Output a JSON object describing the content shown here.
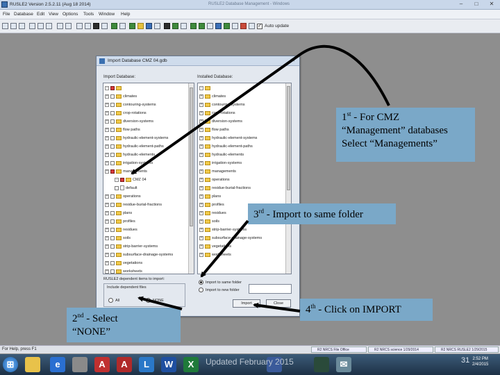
{
  "app": {
    "title": "RUSLE2 Version 2.5.2.11 (Aug 18 2014)",
    "window_title_center": "RUSLE2 Database Management - Windows",
    "min_glyph": "–",
    "max_glyph": "□",
    "close_glyph": "✕"
  },
  "menu": [
    "File",
    "Database",
    "Edit",
    "View",
    "Options",
    "Tools",
    "Window",
    "Help"
  ],
  "toolbar": {
    "checkbox_mark": "✓",
    "checkbox_label": "Auto update"
  },
  "dialog": {
    "title": "Import Database CMZ 04.gdb",
    "close_glyph": "✕",
    "import_label": "Import Database:",
    "installed_label": "Installed Database:",
    "import_tree": [
      {
        "label": "",
        "type": "root",
        "checked": true
      },
      {
        "label": "climates",
        "type": "item"
      },
      {
        "label": "contouring-systems",
        "type": "item"
      },
      {
        "label": "crop-rotations",
        "type": "item"
      },
      {
        "label": "diversion-systems",
        "type": "item"
      },
      {
        "label": "flow paths",
        "type": "item"
      },
      {
        "label": "hydraulic-element-systems",
        "type": "item"
      },
      {
        "label": "hydraulic-element-paths",
        "type": "item"
      },
      {
        "label": "hydraulic-elements",
        "type": "item"
      },
      {
        "label": "irrigation-systems",
        "type": "item"
      },
      {
        "label": "managements",
        "type": "item",
        "checked": true
      },
      {
        "label": "CMZ 04",
        "type": "sub",
        "checked": true
      },
      {
        "label": "default",
        "type": "subdoc"
      },
      {
        "label": "operations",
        "type": "item"
      },
      {
        "label": "residue-burial-fractions",
        "type": "item"
      },
      {
        "label": "plans",
        "type": "item"
      },
      {
        "label": "profiles",
        "type": "item"
      },
      {
        "label": "residues",
        "type": "item"
      },
      {
        "label": "soils",
        "type": "item"
      },
      {
        "label": "strip-barrier-systems",
        "type": "item"
      },
      {
        "label": "subsurface-drainage-systems",
        "type": "item"
      },
      {
        "label": "vegetations",
        "type": "item"
      },
      {
        "label": "worksheets",
        "type": "item"
      }
    ],
    "installed_tree": [
      {
        "label": "",
        "type": "root"
      },
      {
        "label": "climates",
        "type": "folder"
      },
      {
        "label": "contouring-systems",
        "type": "folder"
      },
      {
        "label": "crop-rotations",
        "type": "folder"
      },
      {
        "label": "diversion-systems",
        "type": "folder"
      },
      {
        "label": "flow paths",
        "type": "folder"
      },
      {
        "label": "hydraulic-element-systems",
        "type": "folder"
      },
      {
        "label": "hydraulic-element-paths",
        "type": "folder"
      },
      {
        "label": "hydraulic-elements",
        "type": "folder"
      },
      {
        "label": "irrigation-systems",
        "type": "folder"
      },
      {
        "label": "managements",
        "type": "folder"
      },
      {
        "label": "operations",
        "type": "folder"
      },
      {
        "label": "residue-burial-fractions",
        "type": "folder"
      },
      {
        "label": "plans",
        "type": "folder"
      },
      {
        "label": "profiles",
        "type": "folder"
      },
      {
        "label": "residues",
        "type": "folder"
      },
      {
        "label": "soils",
        "type": "folder"
      },
      {
        "label": "strip-barrier-systems",
        "type": "folder"
      },
      {
        "label": "subsurface-drainage-systems",
        "type": "folder"
      },
      {
        "label": "vegetations",
        "type": "folder"
      },
      {
        "label": "worksheets",
        "type": "folder"
      }
    ],
    "dependents_label": "RUSLE2 dependent items to import:",
    "dependents_group_label": "Include dependent files",
    "dep_options": [
      "All",
      "NONE"
    ],
    "dest_options": [
      "Import to same folder",
      "Import to new folder"
    ],
    "import_button": "Import",
    "close_button": "Close"
  },
  "callouts": {
    "c1": {
      "ord": "1",
      "sup": "st",
      "lines": [
        "- For CMZ",
        "“Management” databases",
        "Select “Managements”"
      ]
    },
    "c2": {
      "ord": "2",
      "sup": "nd",
      "lines": [
        "- Select",
        "“NONE”"
      ]
    },
    "c3": {
      "ord": "3",
      "sup": "rd",
      "text": "- Import to same folder"
    },
    "c4": {
      "ord": "4",
      "sup": "th",
      "text": "- Click on IMPORT"
    }
  },
  "statusbar": {
    "text": "For Help, press F1",
    "tabs": [
      "R2 NRCS File Office",
      "R2 NRCS science 1/29/2014",
      "R2 NRCS RUSLE2 1/29/2015"
    ]
  },
  "footer": {
    "text": "Updated February 2015",
    "slide_number": "31",
    "time": "2:52 PM",
    "date": "2/4/2015"
  },
  "taskbar": {
    "icons": [
      "start-icon",
      "explorer-icon",
      "ie-icon",
      "tools-icon",
      "pdf-icon",
      "pdf-icon-2",
      "lync-icon",
      "word-icon",
      "excel-icon",
      "outlook-icon",
      "app-icon",
      "email-icon"
    ]
  }
}
